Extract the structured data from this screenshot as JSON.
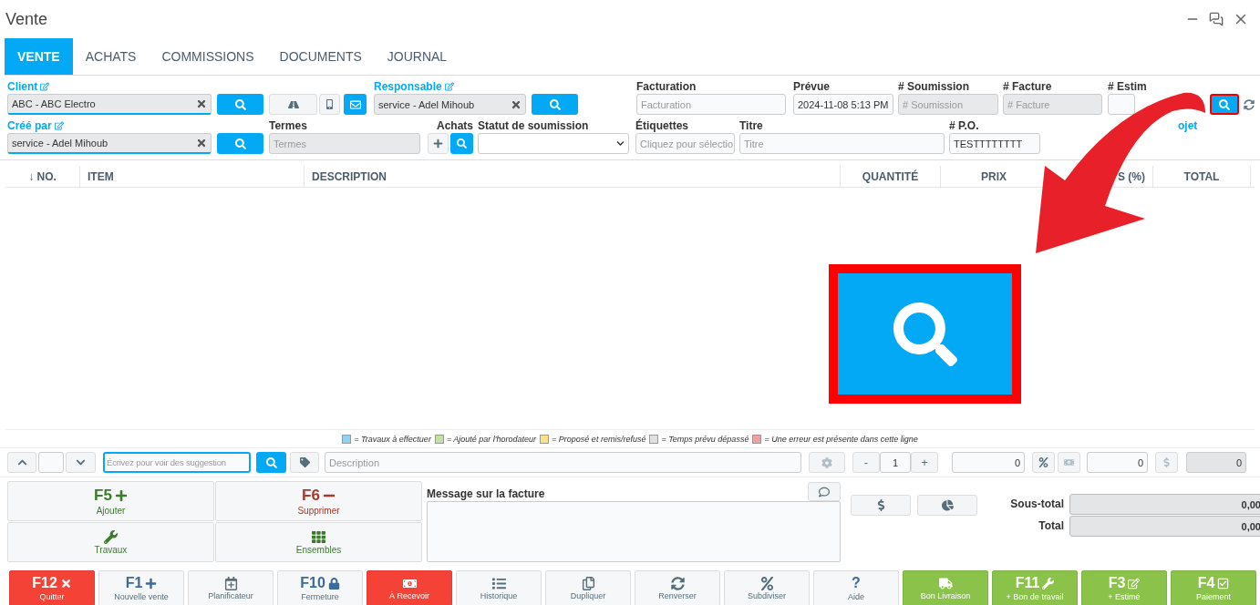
{
  "window": {
    "title": "Vente"
  },
  "tabs": [
    {
      "label": "VENTE",
      "selected": true
    },
    {
      "label": "ACHATS",
      "selected": false
    },
    {
      "label": "COMMISSIONS",
      "selected": false
    },
    {
      "label": "DOCUMENTS",
      "selected": false
    },
    {
      "label": "JOURNAL",
      "selected": false
    }
  ],
  "form": {
    "client": {
      "label": "Client",
      "value": "ABC - ABC Electro"
    },
    "responsable": {
      "label": "Responsable",
      "value": "service - Adel Mihoub"
    },
    "facturation": {
      "label": "Facturation",
      "placeholder": "Facturation"
    },
    "prevue": {
      "label": "Prévue",
      "value": "2024-11-08 5:13 PM"
    },
    "soumission": {
      "label": "# Soumission",
      "placeholder": "# Soumission"
    },
    "facture": {
      "label": "# Facture",
      "placeholder": "# Facture"
    },
    "estime": {
      "label": "# Estim",
      "search_highlighted": true
    },
    "cree_par": {
      "label": "Créé par",
      "value": "service - Adel Mihoub"
    },
    "termes": {
      "label": "Termes",
      "placeholder": "Termes"
    },
    "achats": {
      "label": "Achats"
    },
    "statut": {
      "label": "Statut de soumission"
    },
    "etiquettes": {
      "label": "Étiquettes",
      "placeholder": "Cliquez pour sélectio"
    },
    "titre": {
      "label": "Titre",
      "placeholder": "Titre"
    },
    "po": {
      "label": "# P.O.",
      "value": "TESTTTTTTTT"
    },
    "projet": {
      "label": "ojet"
    }
  },
  "table": {
    "columns": [
      "↓ NO.",
      "ITEM",
      "DESCRIPTION",
      "QUANTITÉ",
      "PRIX",
      "S (%)",
      "TOTAL"
    ]
  },
  "legend": [
    {
      "color": "#8fd3f4",
      "text": "= Travaux à effectuer"
    },
    {
      "color": "#c5e0a5",
      "text": "= Ajouté par l'horodateur"
    },
    {
      "color": "#fde08a",
      "text": "= Proposé et remis/refusé"
    },
    {
      "color": "#e0e0e0",
      "text": "= Temps prévu dépassé"
    },
    {
      "color": "#f4a0a0",
      "text": "= Une erreur est présente dans cette ligne"
    }
  ],
  "entry": {
    "search_placeholder": "Écrivez pour voir des suggestion",
    "description_placeholder": "Description",
    "minus": "-",
    "quantity": "1",
    "plus": "+",
    "discount": "0",
    "cost": "0",
    "total": "0"
  },
  "actions": [
    {
      "key": "F5",
      "label": "Ajouter",
      "kind": "add"
    },
    {
      "key": "F6",
      "label": "Supprimer",
      "kind": "delete"
    },
    {
      "label": "Travaux",
      "kind": "jobs"
    },
    {
      "label": "Ensembles",
      "kind": "sets"
    }
  ],
  "message": {
    "label": "Message sur la facture"
  },
  "totals": [
    {
      "label": "Sous-total",
      "value": "0,00"
    },
    {
      "label": "Total",
      "value": "0,00"
    }
  ],
  "footer_buttons": [
    {
      "key": "F12",
      "label": "Quitter",
      "kind": "quit"
    },
    {
      "key": "F1",
      "label": "Nouvelle vente",
      "kind": "new"
    },
    {
      "label": "Planificateur",
      "kind": "planner"
    },
    {
      "key": "F10",
      "label": "Fermeture",
      "kind": "closing"
    },
    {
      "label": "À Recevoir",
      "kind": "receivable"
    },
    {
      "label": "Historique",
      "kind": "history"
    },
    {
      "label": "Dupliquer",
      "kind": "duplicate"
    },
    {
      "label": "Renverser",
      "kind": "reverse"
    },
    {
      "label": "Subdiviser",
      "kind": "split"
    },
    {
      "key": "?",
      "label": "Aide",
      "kind": "help"
    },
    {
      "label": "Bon Livraison",
      "kind": "delivery"
    },
    {
      "key": "F11",
      "label": "+ Bon de travail",
      "kind": "workorder"
    },
    {
      "key": "F3",
      "label": "+ Estimé",
      "kind": "estimate"
    },
    {
      "key": "F4",
      "label": "Paiement",
      "kind": "payment"
    }
  ]
}
